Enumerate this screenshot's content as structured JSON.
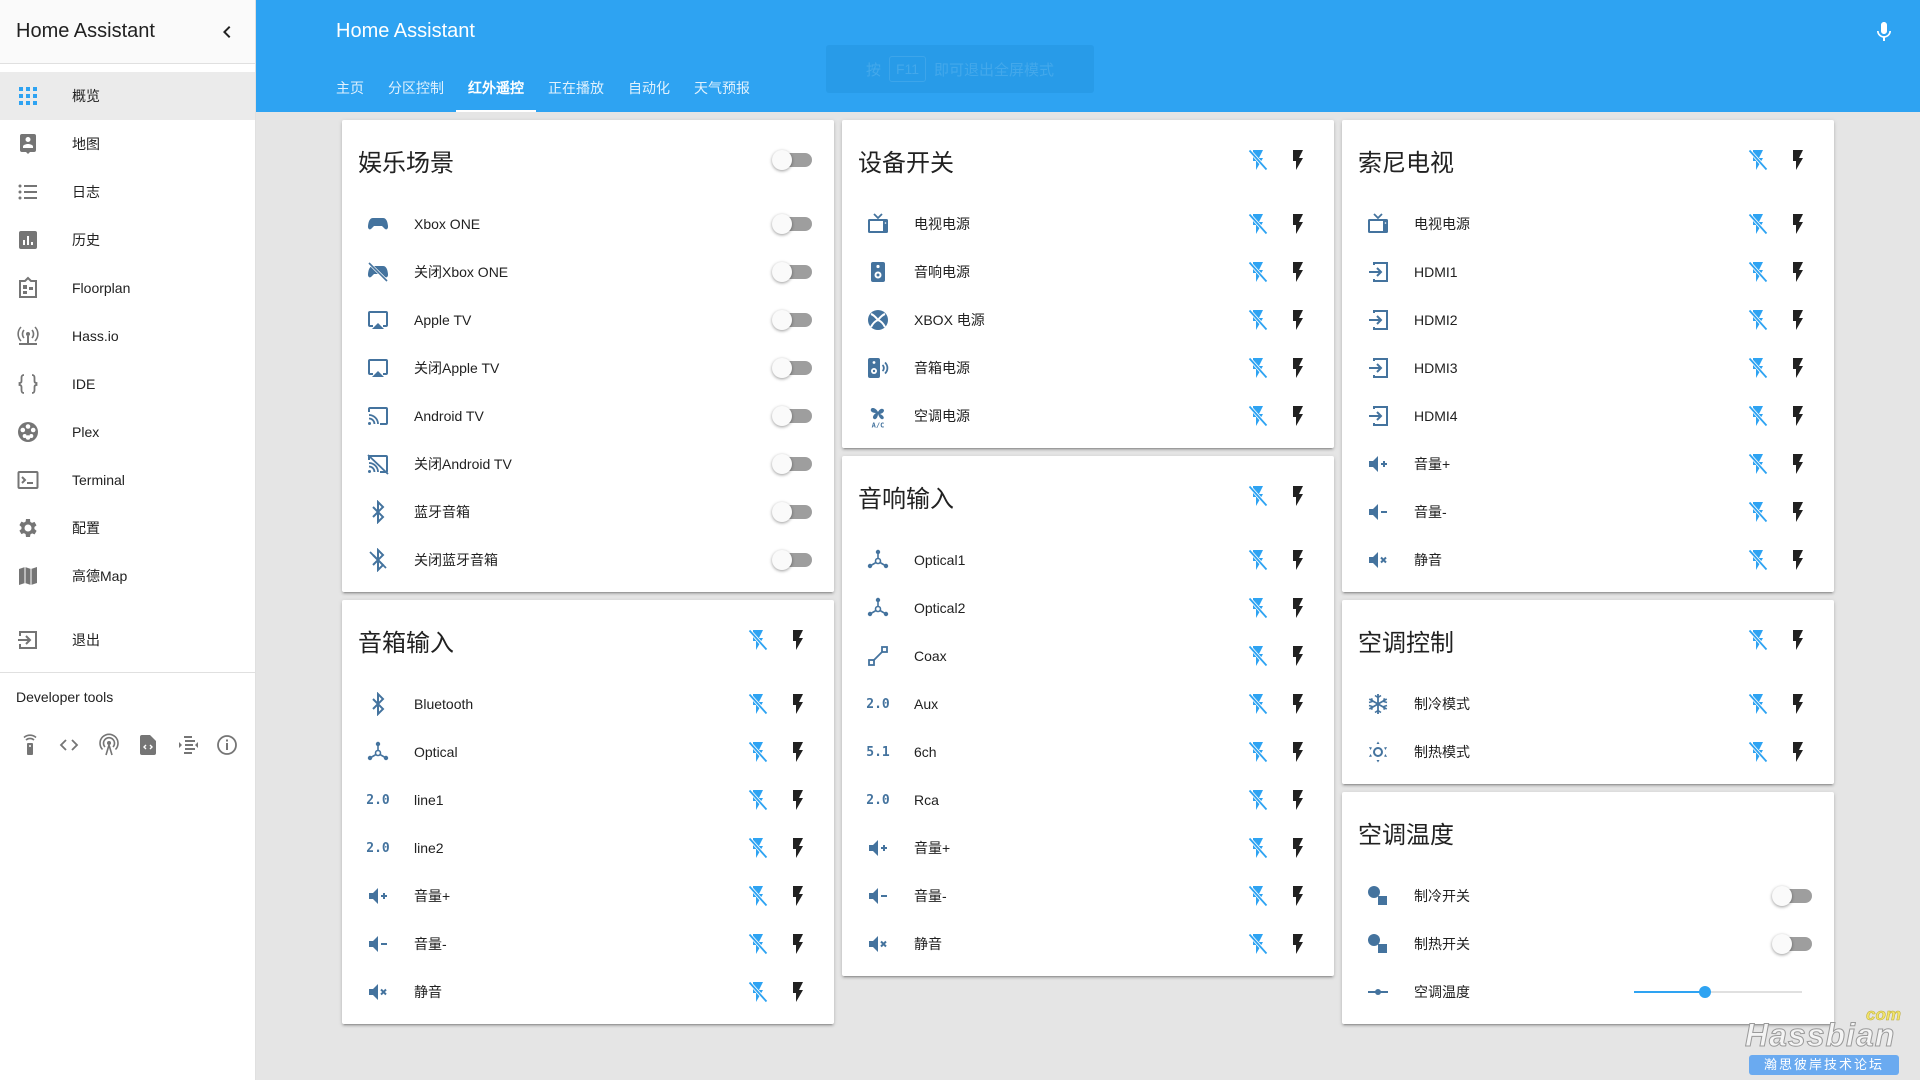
{
  "sidebar": {
    "title": "Home Assistant",
    "items": [
      {
        "label": "概览",
        "icon": "view-dashboard-icon",
        "active": true
      },
      {
        "label": "地图",
        "icon": "account-location-icon"
      },
      {
        "label": "日志",
        "icon": "format-list-bulleted-icon"
      },
      {
        "label": "历史",
        "icon": "chart-box-icon"
      },
      {
        "label": "Floorplan",
        "icon": "floorplan-icon"
      },
      {
        "label": "Hass.io",
        "icon": "hassio-icon"
      },
      {
        "label": "IDE",
        "icon": "code-braces-icon"
      },
      {
        "label": "Plex",
        "icon": "film-reel-icon"
      },
      {
        "label": "Terminal",
        "icon": "console-icon"
      },
      {
        "label": "配置",
        "icon": "settings-icon"
      },
      {
        "label": "高德Map",
        "icon": "map-icon"
      }
    ],
    "logout": {
      "label": "退出",
      "icon": "exit-icon"
    },
    "developer_tools": {
      "title": "Developer tools",
      "tools": [
        "remote-services-icon",
        "code-tags-icon",
        "states-icon",
        "events-icon",
        "templates-icon",
        "info-icon"
      ]
    }
  },
  "header": {
    "title": "Home Assistant",
    "mic_icon": "microphone-icon",
    "tabs": [
      {
        "label": "主页"
      },
      {
        "label": "分区控制"
      },
      {
        "label": "红外遥控",
        "active": true
      },
      {
        "label": "正在播放"
      },
      {
        "label": "自动化"
      },
      {
        "label": "天气预报"
      }
    ],
    "fullscreen_hint": {
      "prefix": "按",
      "key": "F11",
      "suffix": "即可退出全屏模式"
    }
  },
  "cards": {
    "entertainment": {
      "title": "娱乐场景",
      "header_toggle": false,
      "rows": [
        {
          "name": "Xbox ONE",
          "icon": "gamepad-icon",
          "on": false
        },
        {
          "name": "关闭Xbox ONE",
          "icon": "gamepad-off-icon",
          "on": false
        },
        {
          "name": "Apple TV",
          "icon": "airplay-icon",
          "on": false
        },
        {
          "name": "关闭Apple TV",
          "icon": "airplay-icon",
          "on": false
        },
        {
          "name": "Android TV",
          "icon": "cast-icon",
          "on": false
        },
        {
          "name": "关闭Android TV",
          "icon": "cast-off-icon",
          "on": false
        },
        {
          "name": "蓝牙音箱",
          "icon": "bluetooth-icon",
          "on": false
        },
        {
          "name": "关闭蓝牙音箱",
          "icon": "bluetooth-off-icon",
          "on": false
        }
      ]
    },
    "speaker_input": {
      "title": "音箱输入",
      "rows": [
        {
          "name": "Bluetooth",
          "icon": "bluetooth-icon"
        },
        {
          "name": "Optical",
          "icon": "hubspot-icon"
        },
        {
          "name": "line1",
          "icon": "surround-2-0-icon",
          "badge": "2.0"
        },
        {
          "name": "line2",
          "icon": "surround-2-0-icon",
          "badge": "2.0"
        },
        {
          "name": "音量+",
          "icon": "volume-plus-icon"
        },
        {
          "name": "音量-",
          "icon": "volume-minus-icon"
        },
        {
          "name": "静音",
          "icon": "volume-mute-icon"
        }
      ]
    },
    "device_switch": {
      "title": "设备开关",
      "rows": [
        {
          "name": "电视电源",
          "icon": "television-icon"
        },
        {
          "name": "音响电源",
          "icon": "speaker-icon"
        },
        {
          "name": "XBOX 电源",
          "icon": "xbox-icon"
        },
        {
          "name": "音箱电源",
          "icon": "speaker-wireless-icon"
        },
        {
          "name": "空调电源",
          "icon": "air-conditioner-icon"
        }
      ]
    },
    "audio_input": {
      "title": "音响输入",
      "rows": [
        {
          "name": "Optical1",
          "icon": "hubspot-icon"
        },
        {
          "name": "Optical2",
          "icon": "hubspot-icon"
        },
        {
          "name": "Coax",
          "icon": "vector-line-icon"
        },
        {
          "name": "Aux",
          "icon": "surround-2-0-icon",
          "badge": "2.0"
        },
        {
          "name": "6ch",
          "icon": "surround-5-1-icon",
          "badge": "5.1"
        },
        {
          "name": "Rca",
          "icon": "surround-2-0-icon",
          "badge": "2.0"
        },
        {
          "name": "音量+",
          "icon": "volume-plus-icon"
        },
        {
          "name": "音量-",
          "icon": "volume-minus-icon"
        },
        {
          "name": "静音",
          "icon": "volume-mute-icon"
        }
      ]
    },
    "sony_tv": {
      "title": "索尼电视",
      "rows": [
        {
          "name": "电视电源",
          "icon": "television-icon"
        },
        {
          "name": "HDMI1",
          "icon": "input-icon"
        },
        {
          "name": "HDMI2",
          "icon": "input-icon"
        },
        {
          "name": "HDMI3",
          "icon": "input-icon"
        },
        {
          "name": "HDMI4",
          "icon": "input-icon"
        },
        {
          "name": "音量+",
          "icon": "volume-plus-icon"
        },
        {
          "name": "音量-",
          "icon": "volume-minus-icon"
        },
        {
          "name": "静音",
          "icon": "volume-mute-icon"
        }
      ]
    },
    "ac_control": {
      "title": "空调控制",
      "rows": [
        {
          "name": "制冷模式",
          "icon": "snowflake-icon"
        },
        {
          "name": "制热模式",
          "icon": "sun-icon"
        }
      ]
    },
    "ac_temp": {
      "title": "空调温度",
      "rows": [
        {
          "name": "制冷开关",
          "icon": "shape-icon",
          "type": "toggle",
          "on": false
        },
        {
          "name": "制热开关",
          "icon": "shape-icon",
          "type": "toggle",
          "on": false
        },
        {
          "name": "空调温度",
          "icon": "ray-vertex-icon",
          "type": "slider",
          "value_fraction": 0.42
        }
      ]
    }
  },
  "action_icons": {
    "off": "flash-off-icon",
    "on": "flash-icon"
  },
  "colors": {
    "accent": "#2ea3f2",
    "entity_icon": "#44739e",
    "toggle_off_track": "#9e9e9e"
  },
  "watermark": {
    "com": "com",
    "main": "Hassbian",
    "sub": "瀚思彼岸技术论坛"
  }
}
